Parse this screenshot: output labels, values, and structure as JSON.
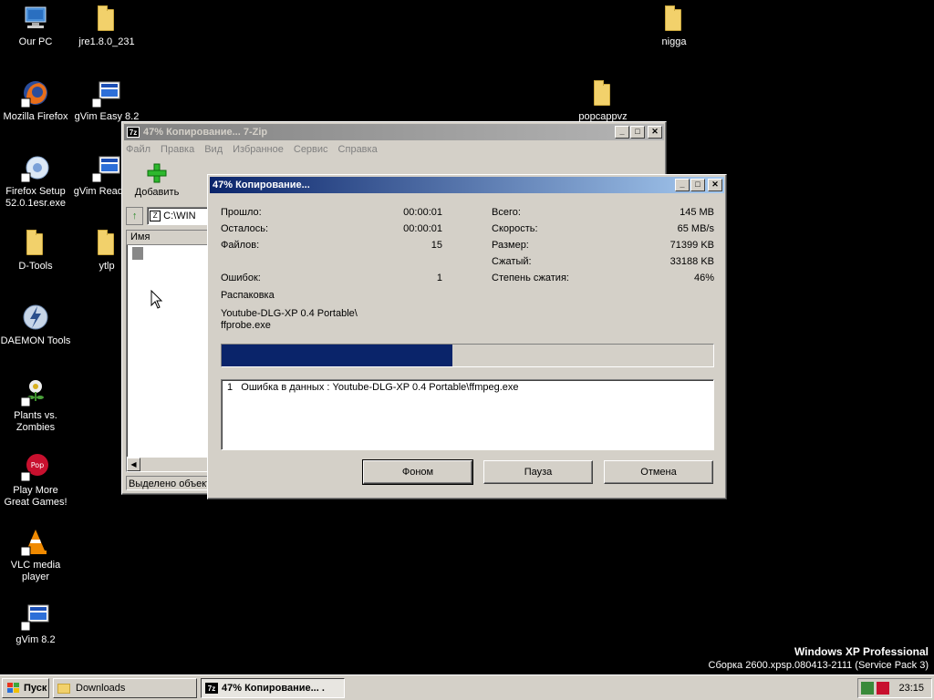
{
  "desktop": {
    "icons": [
      {
        "label": "Our PC",
        "icon": "computer-icon"
      },
      {
        "label": "jre1.8.0_231",
        "icon": "folder-icon"
      },
      {
        "label": "nigga",
        "icon": "folder-icon"
      },
      {
        "label": "Mozilla Firefox",
        "icon": "firefox-icon"
      },
      {
        "label": "gVim Easy 8.2",
        "icon": "gvim-icon"
      },
      {
        "label": "popcappvz",
        "icon": "folder-icon"
      },
      {
        "label": "Firefox Setup 52.0.1esr.exe",
        "icon": "installer-icon"
      },
      {
        "label": "gVim Read 8.2",
        "icon": "gvim-icon"
      },
      {
        "label": "D-Tools",
        "icon": "folder-icon"
      },
      {
        "label": "ytlp",
        "icon": "folder-icon"
      },
      {
        "label": "DAEMON Tools",
        "icon": "daemon-tools-icon"
      },
      {
        "label": "Plants vs. Zombies",
        "icon": "plants-icon"
      },
      {
        "label": "Play More Great Games!",
        "icon": "popcap-icon"
      },
      {
        "label": "VLC media player",
        "icon": "vlc-icon"
      },
      {
        "label": "gVim 8.2",
        "icon": "gvim-icon"
      }
    ],
    "watermark": {
      "line1": "Windows XP Professional",
      "line2": "Сборка 2600.xpsp.080413-2111 (Service Pack 3)"
    }
  },
  "main_window": {
    "title": "47% Копирование... 7-Zip",
    "app_icon": "7z",
    "menu": [
      "Файл",
      "Правка",
      "Вид",
      "Избранное",
      "Сервис",
      "Справка"
    ],
    "toolbar_add": "Добавить",
    "path": "C:\\WIN",
    "column_name": "Имя",
    "status": "Выделено объект"
  },
  "progress_dialog": {
    "title": "47% Копирование...",
    "left_stats": [
      {
        "label": "Прошло:",
        "value": "00:00:01"
      },
      {
        "label": "Осталось:",
        "value": "00:00:01"
      },
      {
        "label": "Файлов:",
        "value": "15"
      }
    ],
    "errors": {
      "label": "Ошибок:",
      "value": "1"
    },
    "right_stats": [
      {
        "label": "Всего:",
        "value": "145 MB"
      },
      {
        "label": "Скорость:",
        "value": "65 MB/s"
      },
      {
        "label": "Размер:",
        "value": "71399 KB"
      },
      {
        "label": "Сжатый:",
        "value": "33188 KB"
      },
      {
        "label": "Степень сжатия:",
        "value": "46%"
      }
    ],
    "operation": "Распаковка",
    "current_path": "Youtube-DLG-XP 0.4 Portable\\",
    "current_file": "ffprobe.exe",
    "progress_percent": 47,
    "error_list": [
      "1   Ошибка в данных : Youtube-DLG-XP 0.4 Portable\\ffmpeg.exe"
    ],
    "buttons": {
      "background": "Фоном",
      "pause": "Пауза",
      "cancel": "Отмена"
    },
    "progress_color": "#0a246a"
  },
  "taskbar": {
    "start": "Пуск",
    "tasks": [
      "Downloads",
      "47% Копирование... ."
    ],
    "clock": "23:15"
  }
}
